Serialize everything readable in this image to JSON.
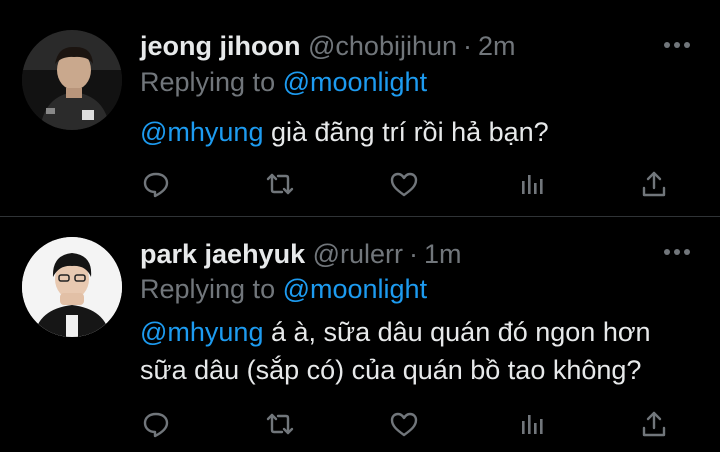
{
  "tweets": [
    {
      "display_name": "jeong jihoon",
      "handle": "@chobijihun",
      "time": "2m",
      "replying_to_prefix": "Replying to ",
      "replying_to": "@moonlight",
      "mention": "@mhyung",
      "text_lines": [
        " già đãng trí rồi hả bạn?"
      ]
    },
    {
      "display_name": "park jaehyuk",
      "handle": "@rulerr",
      "time": "1m",
      "replying_to_prefix": "Replying to ",
      "replying_to": "@moonlight",
      "mention": "@mhyung",
      "text_lines": [
        " á à, sữa dâu quán đó ngon hơn",
        "sữa dâu (sắp có) của quán bồ tao không?"
      ]
    }
  ],
  "separator": "·",
  "colors": {
    "background": "#000000",
    "text": "#e7e9ea",
    "secondary": "#71767b",
    "accent": "#1d9bf0",
    "divider": "#2f3336"
  },
  "icons": [
    "reply-icon",
    "retweet-icon",
    "like-icon",
    "views-icon",
    "share-icon",
    "more-icon"
  ]
}
